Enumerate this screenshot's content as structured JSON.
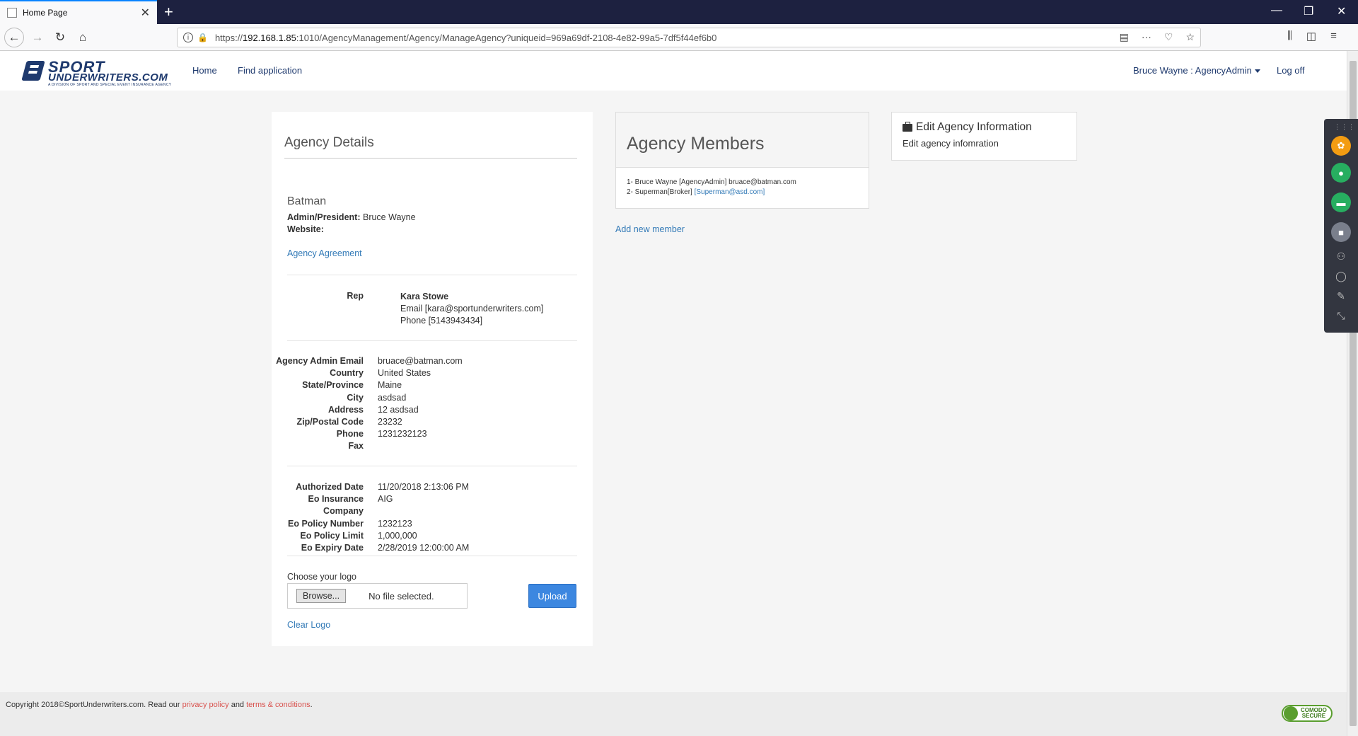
{
  "browser": {
    "tab_title": "Home Page",
    "url_prefix": "https://",
    "url_host": "192.168.1.85",
    "url_rest": ":1010/AgencyManagement/Agency/ManageAgency?uniqueid=969a69df-2108-4e82-99a5-7df5f44ef6b0"
  },
  "header": {
    "logo_line1": "SPORT",
    "logo_line2": "UNDERWRITERS.COM",
    "logo_tagline": "A DIVISION OF SPORT AND SPECIAL EVENT INSURANCE AGENCY",
    "nav": [
      "Home",
      "Find application"
    ],
    "user_menu": "Bruce Wayne : AgencyAdmin",
    "logoff": "Log off"
  },
  "details": {
    "title": "Agency Details",
    "agency_name": "Batman",
    "admin_label": "Admin/President:",
    "admin_value": "Bruce Wayne",
    "website_label": "Website:",
    "website_value": "",
    "agreement_link": "Agency Agreement",
    "rep": {
      "label": "Rep",
      "name": "Kara Stowe",
      "email": "Email [kara@sportunderwriters.com]",
      "phone": "Phone [5143943434]"
    },
    "contact": [
      {
        "label": "Agency Admin Email",
        "value": "bruace@batman.com"
      },
      {
        "label": "Country",
        "value": "United States"
      },
      {
        "label": "State/Province",
        "value": "Maine"
      },
      {
        "label": "City",
        "value": "asdsad"
      },
      {
        "label": "Address",
        "value": "12 asdsad"
      },
      {
        "label": "Zip/Postal Code",
        "value": "23232"
      },
      {
        "label": "Phone",
        "value": "1231232123"
      },
      {
        "label": "Fax",
        "value": ""
      }
    ],
    "policy": [
      {
        "label": "Authorized Date",
        "value": "11/20/2018 2:13:06 PM"
      },
      {
        "label": "Eo Insurance Company",
        "value": "AIG"
      },
      {
        "label": "Eo Policy Number",
        "value": "1232123"
      },
      {
        "label": "Eo Policy Limit",
        "value": "1,000,000"
      },
      {
        "label": "Eo Expiry Date",
        "value": "2/28/2019 12:00:00 AM"
      }
    ],
    "logo_label": "Choose your logo",
    "browse": "Browse...",
    "file_status": "No file selected.",
    "upload": "Upload",
    "clear_logo": "Clear Logo"
  },
  "members": {
    "title": "Agency Members",
    "list": [
      {
        "text": "1- Bruce Wayne [AgencyAdmin] bruace@batman.com",
        "link": ""
      },
      {
        "text": "2- Superman[Broker] ",
        "link": "[Superman@asd.com]"
      }
    ],
    "add_new": "Add new member"
  },
  "edit": {
    "title": "Edit Agency Information",
    "desc": "Edit agency infomration"
  },
  "footer": {
    "text_before": "Copyright 2018©SportUnderwriters.com. Read our ",
    "privacy": "privacy policy",
    "and": " and ",
    "terms": "terms & conditions",
    "end": ".",
    "comodo_line1": "COMODO",
    "comodo_line2": "SECURE"
  },
  "colors": {
    "brand": "#1f3a6e",
    "link": "#337ab7",
    "upload_button": "#3c87e0",
    "footer_link": "#d9534f"
  }
}
